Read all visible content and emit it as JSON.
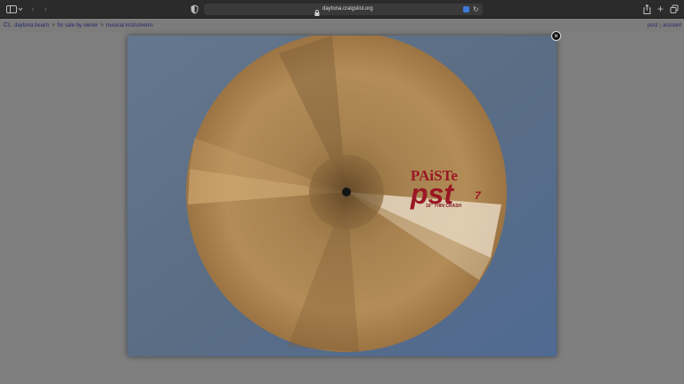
{
  "browser": {
    "url": "daytona.craigslist.org",
    "reload_glyph": "↻",
    "back_glyph": "‹",
    "forward_glyph": "›",
    "new_tab_glyph": "+"
  },
  "page": {
    "logo": "CL",
    "breadcrumb": [
      "daytona beach",
      "for sale by owner",
      "musical instruments"
    ],
    "breadcrumb_separator": ">",
    "links": {
      "post": "post",
      "account": "account",
      "divider": "|"
    }
  },
  "lightbox": {
    "close_glyph": "×",
    "cymbal": {
      "brand": "PAiSTe",
      "model": "pst",
      "model_number": "7",
      "size_label": "16\" THIN CRASH"
    }
  },
  "colors": {
    "overlay": "#7f7f7f",
    "link": "#27276b",
    "logo_red": "#9a1724",
    "cymbal_bronze": "#a97f4c",
    "background_fabric": "#5d7189"
  },
  "icons": [
    "sidebar-icon",
    "chevron-down-icon",
    "back-arrow-icon",
    "forward-arrow-icon",
    "shield-icon",
    "lock-icon",
    "extension-icon",
    "reload-icon",
    "share-icon",
    "plus-icon",
    "tabs-icon",
    "close-icon"
  ]
}
